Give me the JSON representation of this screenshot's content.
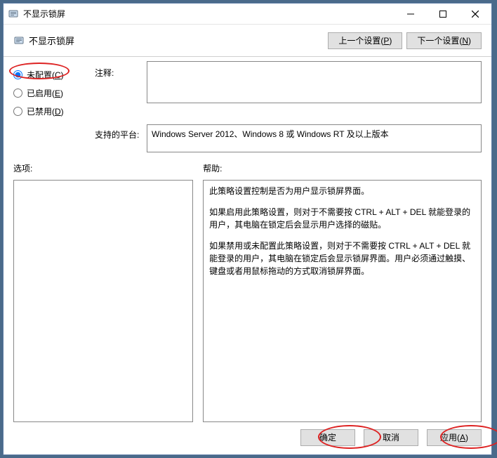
{
  "window": {
    "title": "不显示锁屏"
  },
  "subheader": {
    "title": "不显示锁屏"
  },
  "nav": {
    "prev": "上一个设置(P)",
    "next": "下一个设置(N)"
  },
  "radios": {
    "notconfigured": "未配置(C)",
    "enabled": "已启用(E)",
    "disabled": "已禁用(D)",
    "selected": "notconfigured"
  },
  "labels": {
    "comment": "注释:",
    "platform": "支持的平台:",
    "options": "选项:",
    "help": "帮助:"
  },
  "comment": "",
  "platform": "Windows Server 2012、Windows 8 或 Windows RT 及以上版本",
  "options_body": "",
  "help_paragraphs": [
    "此策略设置控制是否为用户显示锁屏界面。",
    "如果启用此策略设置，则对于不需要按 CTRL + ALT + DEL  就能登录的用户，其电脑在锁定后会显示用户选择的磁贴。",
    "如果禁用或未配置此策略设置，则对于不需要按 CTRL + ALT + DEL 就能登录的用户，其电脑在锁定后会显示锁屏界面。用户必须通过触摸、键盘或者用鼠标拖动的方式取消锁屏界面。"
  ],
  "footer": {
    "ok": "确定",
    "cancel": "取消",
    "apply": "应用(A)"
  }
}
